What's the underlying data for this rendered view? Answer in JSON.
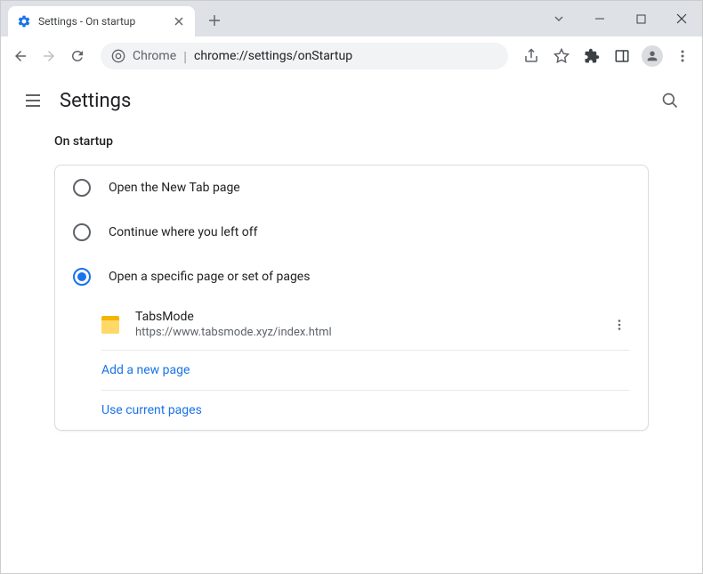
{
  "tab": {
    "title": "Settings - On startup"
  },
  "omnibox": {
    "prefix": "Chrome",
    "url": "chrome://settings/onStartup"
  },
  "header": {
    "title": "Settings"
  },
  "section": {
    "title": "On startup"
  },
  "radios": {
    "new_tab": "Open the New Tab page",
    "continue": "Continue where you left off",
    "specific": "Open a specific page or set of pages"
  },
  "pages": [
    {
      "name": "TabsMode",
      "url": "https://www.tabsmode.xyz/index.html"
    }
  ],
  "actions": {
    "add_page": "Add a new page",
    "use_current": "Use current pages"
  }
}
